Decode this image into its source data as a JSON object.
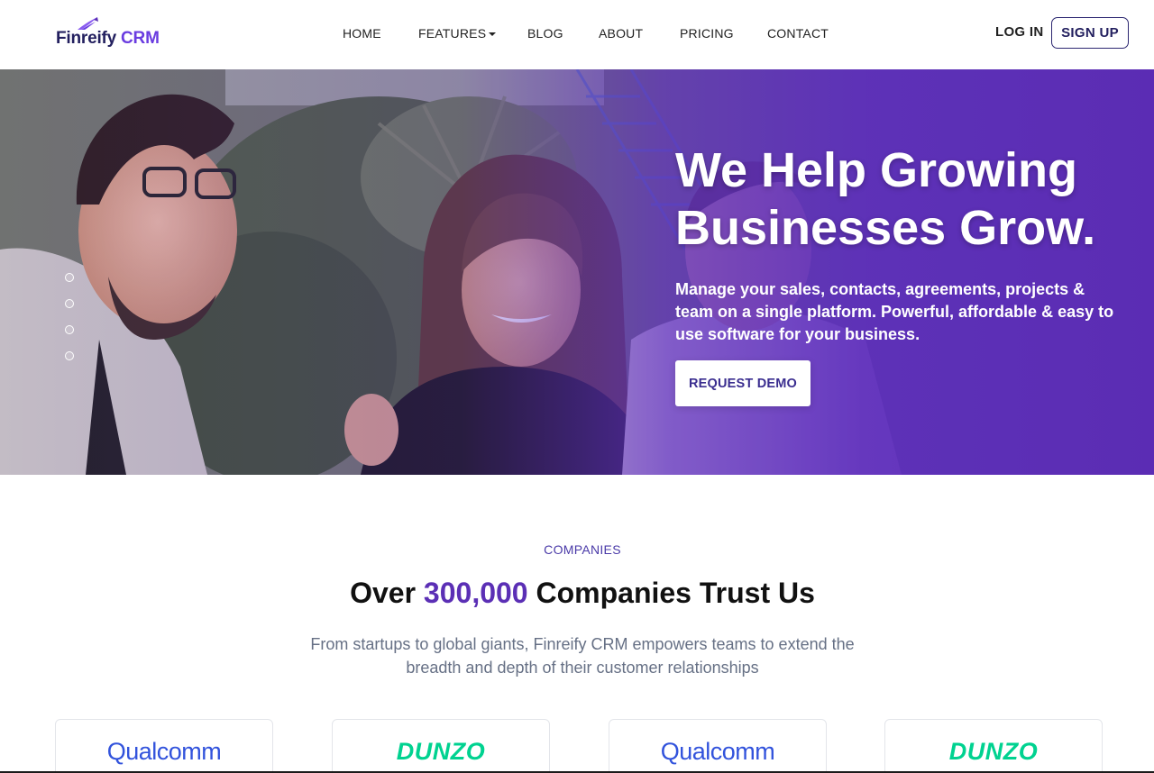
{
  "brand": {
    "name": "Finreify",
    "suffix": "CRM",
    "primary_color": "#23205f",
    "accent_color": "#6a3ce0"
  },
  "nav": {
    "items": [
      {
        "label": "HOME"
      },
      {
        "label": "FEATURES",
        "has_dropdown": true
      },
      {
        "label": "BLOG"
      },
      {
        "label": "ABOUT"
      },
      {
        "label": "PRICING"
      },
      {
        "label": "CONTACT"
      }
    ],
    "login_label": "LOG IN",
    "signup_label": "SIGN UP"
  },
  "hero": {
    "title_line1": "We Help Growing",
    "title_line2": "Businesses Grow.",
    "subtitle": "Manage your sales, contacts, agreements, projects & team on a single platform. Powerful, affordable & easy to use software for your business.",
    "cta_label": "REQUEST DEMO",
    "slide_count": 4,
    "overlay_color": "#5a2ab9"
  },
  "companies": {
    "eyebrow": "COMPANIES",
    "title_prefix": "Over ",
    "title_highlight": "300,000",
    "title_suffix": " Companies Trust Us",
    "description": "From startups to global giants, Finreify CRM empowers teams to extend the breadth and depth of their customer relationships",
    "logos": [
      "Qualcomm",
      "DUNZO",
      "Qualcomm",
      "DUNZO"
    ],
    "qualcomm_color": "#3253dc",
    "dunzo_color": "#00d290"
  }
}
